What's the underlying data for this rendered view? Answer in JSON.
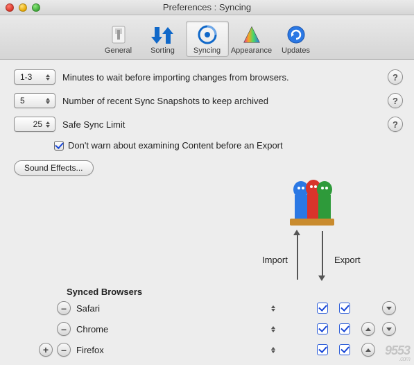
{
  "window": {
    "title": "Preferences : Syncing"
  },
  "toolbar": {
    "items": [
      {
        "label": "General"
      },
      {
        "label": "Sorting"
      },
      {
        "label": "Syncing"
      },
      {
        "label": "Appearance"
      },
      {
        "label": "Updates"
      }
    ],
    "active_index": 2
  },
  "settings": {
    "minutes_value": "1-3",
    "minutes_label": "Minutes to wait before importing changes from browsers.",
    "snapshots_value": "5",
    "snapshots_label": "Number of recent Sync Snapshots to keep archived",
    "safe_limit_value": "25",
    "safe_limit_label": "Safe Sync Limit",
    "dont_warn_label": "Don't warn about examining Content before an Export",
    "dont_warn_checked": true,
    "sound_effects_label": "Sound Effects..."
  },
  "columns": {
    "import": "Import",
    "export": "Export"
  },
  "browsers": {
    "section_title": "Synced Browsers",
    "rows": [
      {
        "name": "Safari",
        "import": true,
        "export": true,
        "show_up": false,
        "show_down": true
      },
      {
        "name": "Chrome",
        "import": true,
        "export": true,
        "show_up": true,
        "show_down": true
      },
      {
        "name": "Firefox",
        "import": true,
        "export": true,
        "show_up": true,
        "show_down": false
      }
    ]
  },
  "help_glyph": "?",
  "minus_glyph": "–",
  "plus_glyph": "+",
  "watermark": {
    "main": "9553",
    "sub": ".com"
  }
}
